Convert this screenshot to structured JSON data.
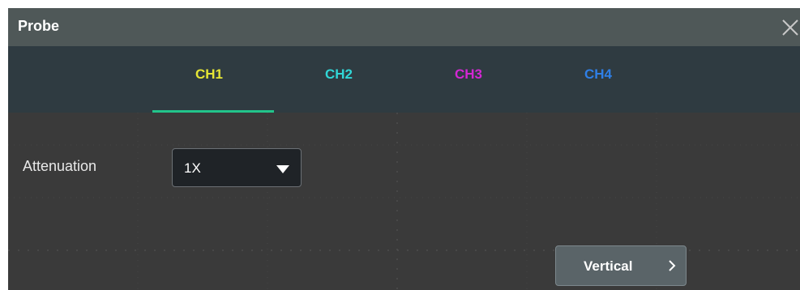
{
  "dialog": {
    "title": "Probe",
    "close_icon": "close-icon"
  },
  "tabs": [
    {
      "label": "CH1",
      "color": "#e6e635",
      "selected": true
    },
    {
      "label": "CH2",
      "color": "#31d6d6",
      "selected": false
    },
    {
      "label": "CH3",
      "color": "#d327d3",
      "selected": false
    },
    {
      "label": "CH4",
      "color": "#2f7fe6",
      "selected": false
    }
  ],
  "attenuation": {
    "label": "Attenuation",
    "value": "1X",
    "dropdown_icon": "caret-down-icon"
  },
  "vertical_button": {
    "label": "Vertical",
    "icon": "chevron-right-icon"
  }
}
